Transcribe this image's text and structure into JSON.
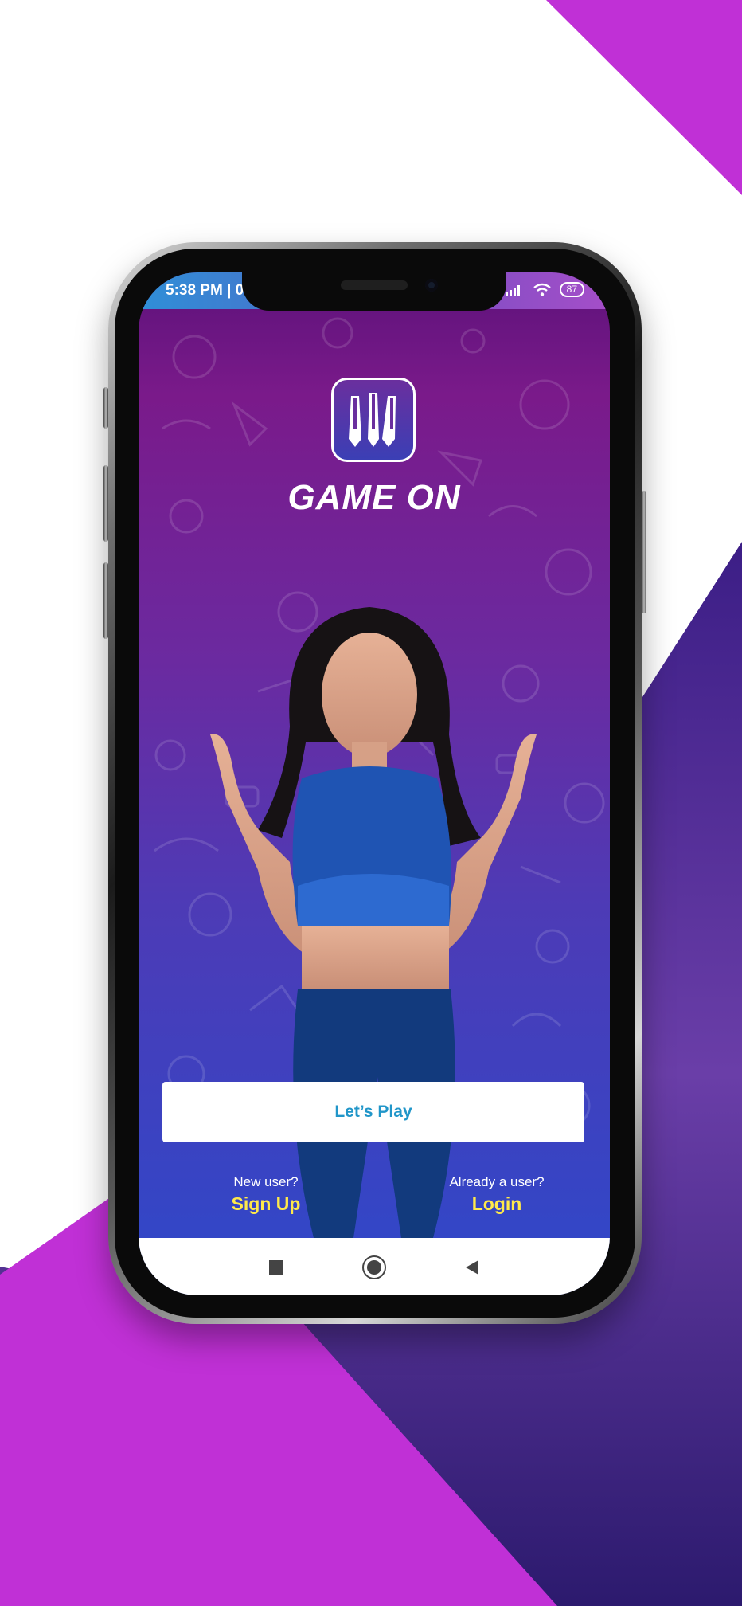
{
  "status_bar": {
    "time": "5:38 PM | 0.",
    "battery": "87"
  },
  "app": {
    "title": "GAME ON"
  },
  "cta": {
    "label": "Let’s Play"
  },
  "auth": {
    "signup_prompt": "New user?",
    "signup_label": "Sign Up",
    "login_prompt": "Already a user?",
    "login_label": "Login"
  },
  "nav": {
    "icons": [
      "recents-square-icon",
      "home-circle-icon",
      "back-triangle-icon"
    ]
  },
  "colors": {
    "accent_link": "#ffe94a",
    "cta_text": "#2196c9",
    "background_magenta": "#c030d6",
    "background_purple": "#4a2a9a"
  }
}
